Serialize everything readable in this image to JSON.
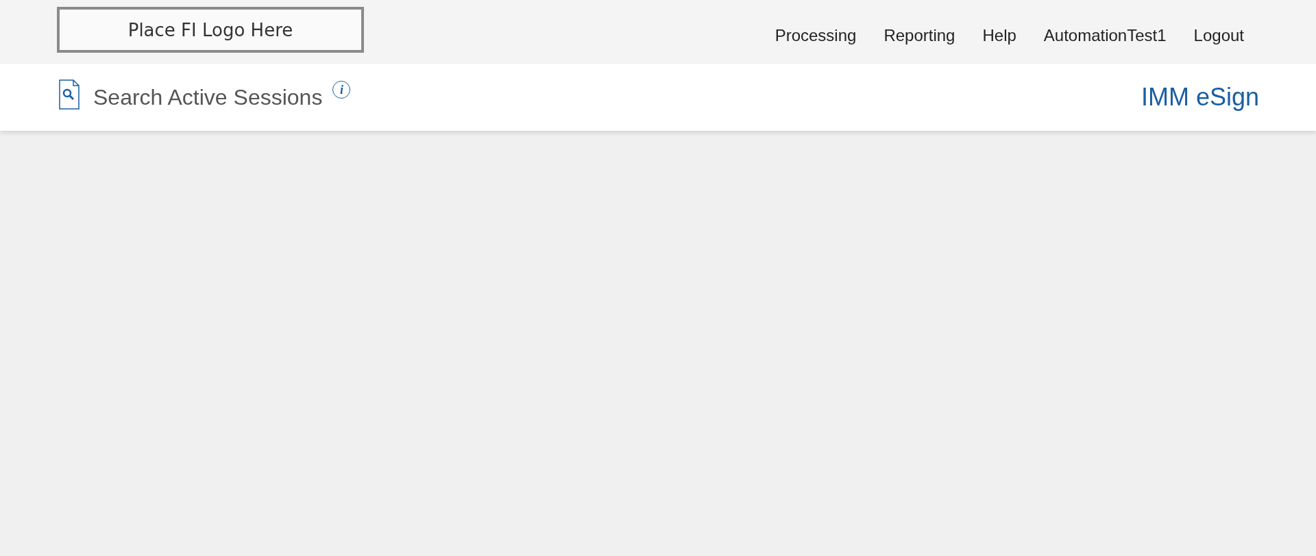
{
  "header": {
    "logo_text": "Place FI Logo Here",
    "nav": [
      {
        "label": "Processing"
      },
      {
        "label": "Reporting"
      },
      {
        "label": "Help"
      },
      {
        "label": "AutomationTest1"
      },
      {
        "label": "Logout"
      }
    ]
  },
  "subheader": {
    "title": "Search Active Sessions",
    "info_icon": "i",
    "product": "IMM eSign"
  }
}
